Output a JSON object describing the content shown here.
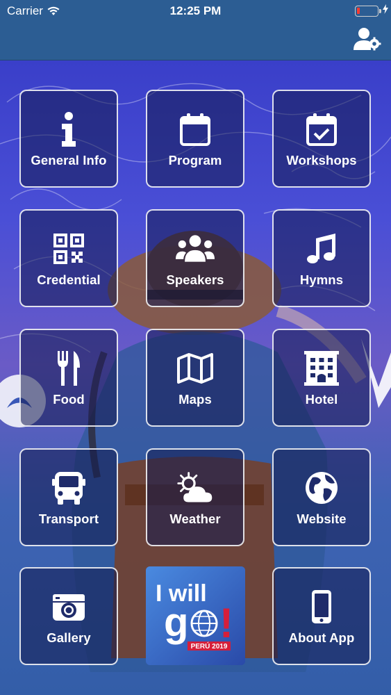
{
  "status_bar": {
    "carrier": "Carrier",
    "time": "12:25 PM"
  },
  "header": {
    "settings_icon": "user-gear-icon"
  },
  "tiles": [
    {
      "label": "General Info",
      "icon": "info-icon"
    },
    {
      "label": "Program",
      "icon": "calendar-icon"
    },
    {
      "label": "Workshops",
      "icon": "calendar-check-icon"
    },
    {
      "label": "Credential",
      "icon": "qr-code-icon"
    },
    {
      "label": "Speakers",
      "icon": "users-icon"
    },
    {
      "label": "Hymns",
      "icon": "music-note-icon"
    },
    {
      "label": "Food",
      "icon": "utensils-icon"
    },
    {
      "label": "Maps",
      "icon": "map-icon"
    },
    {
      "label": "Hotel",
      "icon": "building-icon"
    },
    {
      "label": "Transport",
      "icon": "bus-icon"
    },
    {
      "label": "Weather",
      "icon": "cloud-sun-icon"
    },
    {
      "label": "Website",
      "icon": "globe-icon"
    },
    {
      "label": "Gallery",
      "icon": "camera-icon"
    },
    {
      "label": "About App",
      "icon": "mobile-icon"
    }
  ],
  "logo": {
    "line1": "I will",
    "line2": "g",
    "line3": "!",
    "tag": "PERÚ 2019"
  },
  "colors": {
    "header": "#2c5d93",
    "background_top": "#3a3fc9",
    "background_bottom": "#335ea8",
    "tile_border": "#ffffff",
    "logo_red": "#d61f3a"
  }
}
